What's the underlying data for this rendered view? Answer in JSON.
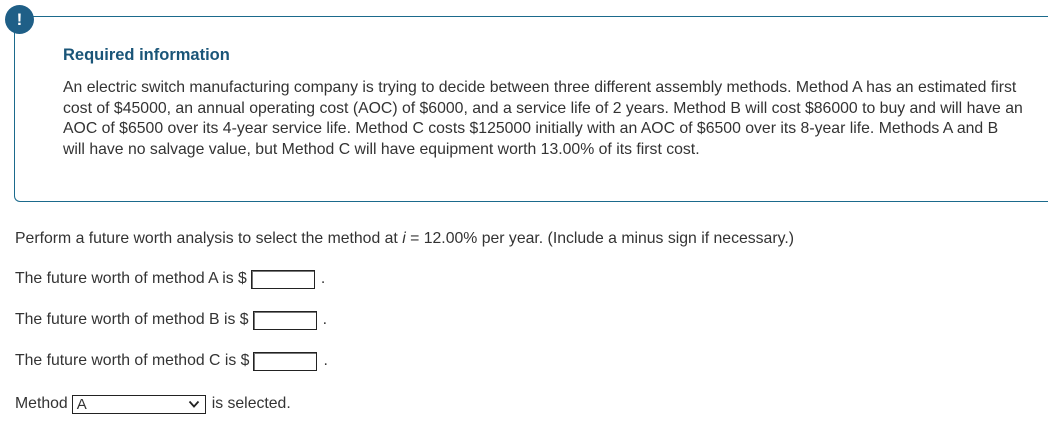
{
  "info": {
    "badge": "!",
    "title": "Required information",
    "body": "An electric switch manufacturing company is trying to decide between three different assembly methods. Method A has an estimated first cost of $45000, an annual operating cost (AOC) of $6000, and a service life of 2 years. Method B will cost $86000 to buy and will have an AOC of $6500 over its 4-year service life. Method C costs $125000 initially with an AOC of $6500 over its 8-year life. Methods A and B will have no salvage value, but Method C will have equipment worth 13.00% of its first cost."
  },
  "question": {
    "prefix": "Perform a future worth analysis to select the method at ",
    "var": "i",
    "suffix": " = 12.00% per year. (Include a minus sign if necessary.)"
  },
  "answers": [
    {
      "label": "The future worth of method A is $",
      "value": "",
      "after": "."
    },
    {
      "label": "The future worth of method B is $",
      "value": "",
      "after": "."
    },
    {
      "label": "The future worth of method C is $",
      "value": "",
      "after": "."
    }
  ],
  "selection": {
    "prefix": "Method",
    "selected": "A",
    "suffix": "is selected."
  },
  "colors": {
    "accent": "#1f5f87",
    "border": "#1b6a8c",
    "title": "#1a5578",
    "text": "#333333"
  }
}
